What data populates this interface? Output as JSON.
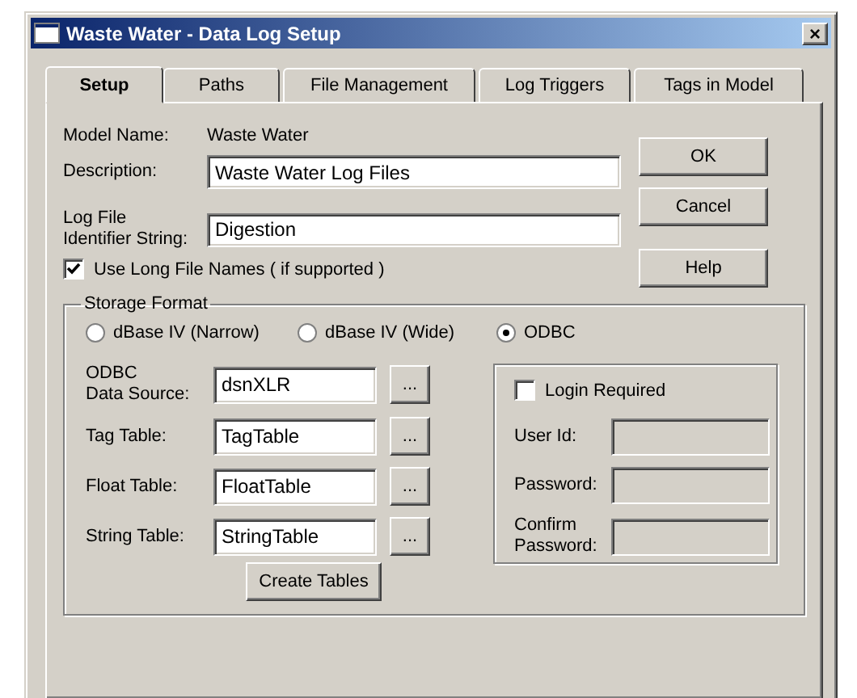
{
  "window": {
    "title": "Waste Water - Data Log Setup",
    "close": "×"
  },
  "tabs": [
    {
      "label": "Setup",
      "selected": true
    },
    {
      "label": "Paths",
      "selected": false
    },
    {
      "label": "File Management",
      "selected": false
    },
    {
      "label": "Log Triggers",
      "selected": false
    },
    {
      "label": "Tags in Model",
      "selected": false
    }
  ],
  "model_name": {
    "label": "Model Name:",
    "value": "Waste Water"
  },
  "description": {
    "label": "Description:",
    "value": "Waste Water Log Files"
  },
  "log_file_identifier": {
    "label": "Log File\nIdentifier String:",
    "value": "Digestion"
  },
  "buttons": [
    "OK",
    "Cancel",
    "Help"
  ],
  "long_file_names": {
    "label": "Use Long File Names ( if supported )",
    "checked": true
  },
  "storage_format": {
    "title": "Storage Format",
    "options": [
      {
        "label": "dBase IV (Narrow)",
        "selected": false
      },
      {
        "label": "dBase IV (Wide)",
        "selected": false
      },
      {
        "label": "ODBC",
        "selected": true
      }
    ],
    "fields": [
      {
        "label": "ODBC\nData Source:",
        "value": "dsnXLR",
        "browse": "..."
      },
      {
        "label": "Tag Table:",
        "value": "TagTable",
        "browse": "..."
      },
      {
        "label": "Float Table:",
        "value": "FloatTable",
        "browse": "..."
      },
      {
        "label": "String Table:",
        "value": "StringTable",
        "browse": "..."
      }
    ],
    "create_button": "Create Tables",
    "login": {
      "label": "Login Required",
      "checked": false,
      "fields": [
        {
          "label": "User Id:",
          "disabled": true
        },
        {
          "label": "Password:",
          "disabled": true
        },
        {
          "label": "Confirm\nPassword:",
          "disabled": true
        }
      ]
    }
  }
}
